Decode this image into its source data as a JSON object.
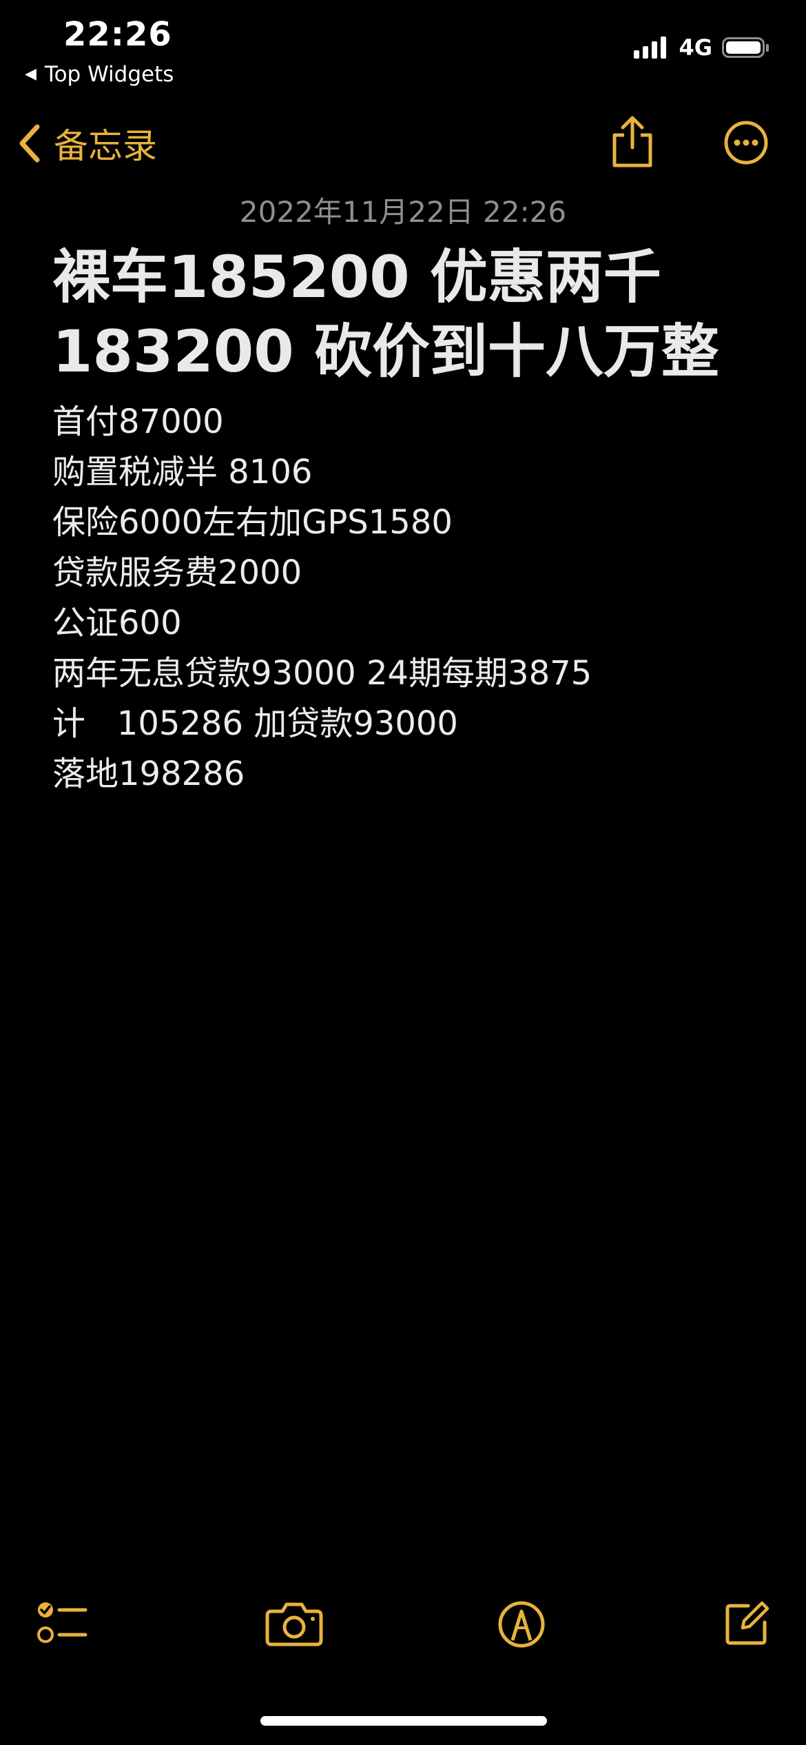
{
  "status_bar": {
    "time": "22:26",
    "back_app": "Top Widgets",
    "network": "4G"
  },
  "nav": {
    "back_label": "备忘录",
    "share_icon": "share-icon",
    "more_icon": "more-icon"
  },
  "note": {
    "date": "2022年11月22日 22:26",
    "title_lines": [
      "裸车185200 优惠两千",
      "183200 砍价到十八万整"
    ],
    "lines": [
      "首付87000",
      "购置税减半 8106",
      "保险6000左右加GPS1580",
      "贷款服务费2000",
      "公证600",
      "两年无息贷款93000 24期每期3875",
      "计   105286 加贷款93000",
      "落地198286"
    ]
  },
  "toolbar": {
    "checklist_icon": "checklist-icon",
    "camera_icon": "camera-icon",
    "markup_icon": "markup-icon",
    "compose_icon": "compose-icon"
  },
  "colors": {
    "accent": "#e8b23f",
    "background": "#000000",
    "text": "#ececec",
    "secondary": "#8e8e93"
  }
}
